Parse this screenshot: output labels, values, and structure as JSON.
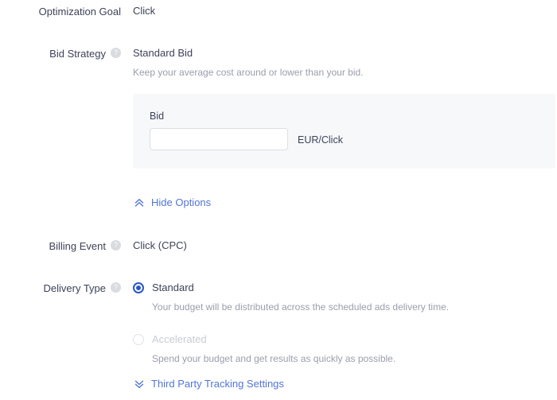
{
  "form": {
    "optimization_goal": {
      "label": "Optimization Goal",
      "value": "Click"
    },
    "bid_strategy": {
      "label": "Bid Strategy",
      "help_glyph": "?",
      "value": "Standard Bid",
      "description": "Keep your average cost around or lower than your bid.",
      "panel": {
        "field_label": "Bid",
        "input_value": "",
        "input_placeholder": "",
        "unit": "EUR/Click"
      },
      "toggle_link": {
        "label": "Hide Options",
        "icon": "chevron-double-up-icon"
      }
    },
    "billing_event": {
      "label": "Billing Event",
      "help_glyph": "?",
      "value": "Click (CPC)"
    },
    "delivery_type": {
      "label": "Delivery Type",
      "help_glyph": "?",
      "options": [
        {
          "label": "Standard",
          "description": "Your budget will be distributed across the scheduled ads delivery time.",
          "selected": true,
          "disabled": false
        },
        {
          "label": "Accelerated",
          "description": "Spend your budget and get results as quickly as possible.",
          "selected": false,
          "disabled": true
        }
      ]
    },
    "third_party_tracking": {
      "label": "Third Party Tracking Settings",
      "icon": "chevron-double-down-icon"
    }
  },
  "colors": {
    "link": "#5276d4",
    "radio_accent": "#2a57c4",
    "panel_bg": "#f7f8fa",
    "text": "#3d4358",
    "muted_text": "#9a9ead",
    "disabled_text": "#c9ccd6"
  }
}
